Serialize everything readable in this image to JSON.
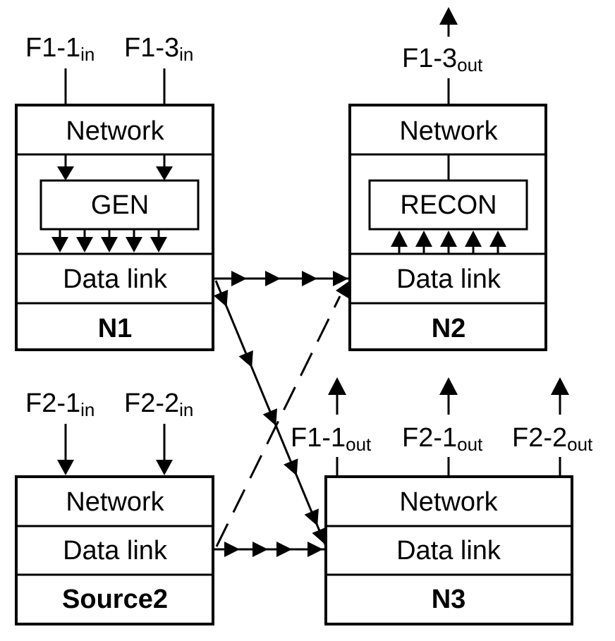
{
  "nodes": {
    "n1": {
      "name": "N1",
      "network": "Network",
      "inner": "GEN",
      "datalink": "Data link"
    },
    "n2": {
      "name": "N2",
      "network": "Network",
      "inner": "RECON",
      "datalink": "Data link"
    },
    "source2": {
      "name": "Source2",
      "network": "Network",
      "datalink": "Data link"
    },
    "n3": {
      "name": "N3",
      "network": "Network",
      "datalink": "Data link"
    }
  },
  "flows": {
    "f1_1_in": {
      "main": "F1-1",
      "sub": "in"
    },
    "f1_3_in": {
      "main": "F1-3",
      "sub": "in"
    },
    "f2_1_in": {
      "main": "F2-1",
      "sub": "in"
    },
    "f2_2_in": {
      "main": "F2-2",
      "sub": "in"
    },
    "f1_3_out": {
      "main": "F1-3",
      "sub": "out"
    },
    "f1_1_out": {
      "main": "F1-1",
      "sub": "out"
    },
    "f2_1_out": {
      "main": "F2-1",
      "sub": "out"
    },
    "f2_2_out": {
      "main": "F2-2",
      "sub": "out"
    }
  },
  "colors": {
    "stroke": "#000000",
    "background": "#ffffff"
  }
}
